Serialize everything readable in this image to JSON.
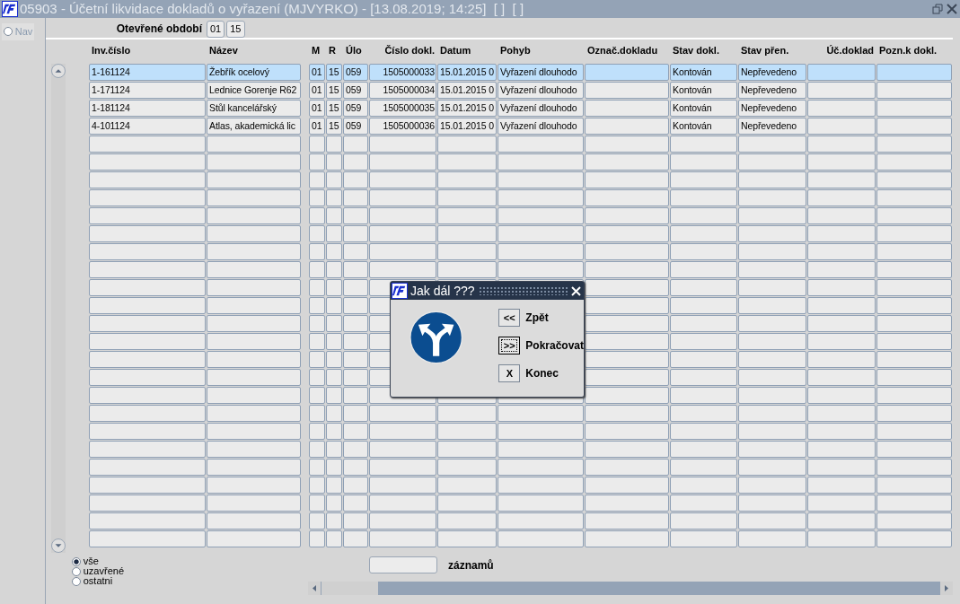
{
  "window": {
    "title": "05903 - Účetní likvidace dokladů o vyřazení (MJVYRKO) - [13.08.2019; 14:25]  [ ]  [ ]"
  },
  "nav": {
    "label": "Nav",
    "selected": false
  },
  "period": {
    "label": "Otevřené období",
    "month": "01",
    "year": "15"
  },
  "table": {
    "columns": [
      {
        "label": "Inv.číslo"
      },
      {
        "label": "Název"
      },
      {
        "label": "M"
      },
      {
        "label": "R"
      },
      {
        "label": "Úlo"
      },
      {
        "label": "Číslo dokl."
      },
      {
        "label": "Datum"
      },
      {
        "label": "Pohyb"
      },
      {
        "label": "Označ.dokladu"
      },
      {
        "label": "Stav dokl."
      },
      {
        "label": "Stav přen."
      },
      {
        "label": "Úč.doklad"
      },
      {
        "label": "Pozn.k dokl."
      }
    ],
    "rows": [
      {
        "selected": true,
        "cells": [
          "1-161124",
          "Žebřík ocelový",
          "01",
          "15",
          "059",
          "1505000033",
          "15.01.2015 0",
          "Vyřazení dlouhodo",
          null,
          "Kontován",
          "Nepřevedeno",
          null,
          null
        ]
      },
      {
        "selected": false,
        "cells": [
          "1-171124",
          "Lednice Gorenje R62",
          "01",
          "15",
          "059",
          "1505000034",
          "15.01.2015 0",
          "Vyřazení dlouhodo",
          null,
          "Kontován",
          "Nepřevedeno",
          null,
          null
        ]
      },
      {
        "selected": false,
        "cells": [
          "1-181124",
          "Stůl kancelářský",
          "01",
          "15",
          "059",
          "1505000035",
          "15.01.2015 0",
          "Vyřazení dlouhodo",
          null,
          "Kontován",
          "Nepřevedeno",
          null,
          null
        ]
      },
      {
        "selected": false,
        "cells": [
          "4-101124",
          "Atlas, akademická lic",
          "01",
          "15",
          "059",
          "1505000036",
          "15.01.2015 0",
          "Vyřazení dlouhodo",
          null,
          "Kontován",
          "Nepřevedeno",
          null,
          null
        ]
      }
    ]
  },
  "filter_options": [
    {
      "label": "vše",
      "selected": true
    },
    {
      "label": "uzavřené",
      "selected": false
    },
    {
      "label": "ostatni",
      "selected": false
    }
  ],
  "records": {
    "label": "záznamů"
  },
  "dialog": {
    "title": "Jak dál ???",
    "buttons": [
      {
        "key": "<<",
        "label": "Zpět",
        "focused": false
      },
      {
        "key": ">>",
        "label": "Pokračovat",
        "focused": true
      },
      {
        "key": "X",
        "label": "Konec",
        "focused": false
      }
    ]
  }
}
